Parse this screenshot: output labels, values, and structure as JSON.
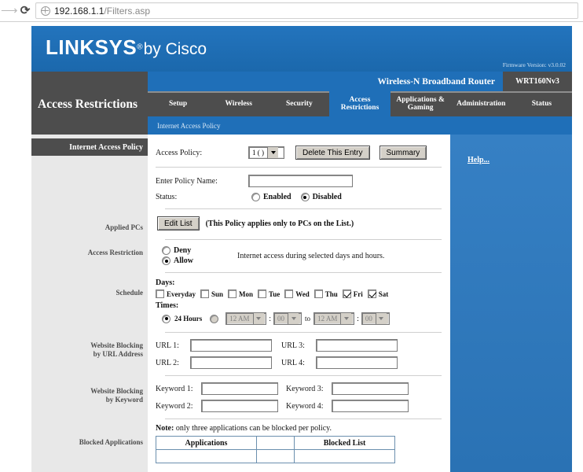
{
  "browser": {
    "forward_icon": "forward-arrow-icon",
    "reload_icon": "reload-icon",
    "reload_glyph": "⟳",
    "site_icon": "globe-icon",
    "url_host": "192.168.1.1",
    "url_path": "/Filters.asp"
  },
  "masthead": {
    "brand": "LINKSYS",
    "brand_reg": "®",
    "brand_suffix": "by Cisco",
    "firmware": "Firmware Version: v3.0.02",
    "router_name": "Wireless-N Broadband Router",
    "model": "WRT160Nv3"
  },
  "nav": {
    "section_title": "Access Restrictions",
    "tabs": [
      {
        "label": "Setup",
        "active": false
      },
      {
        "label": "Wireless",
        "active": false
      },
      {
        "label": "Security",
        "active": false
      },
      {
        "label": "Access Restrictions",
        "active": true
      },
      {
        "label": "Applications & Gaming",
        "active": false
      },
      {
        "label": "Administration",
        "active": false
      },
      {
        "label": "Status",
        "active": false
      }
    ],
    "subtabs": [
      {
        "label": "Internet Access Policy",
        "active": true
      }
    ]
  },
  "sidebar": {
    "header": "Internet Access Policy",
    "items": [
      {
        "label": "Applied PCs"
      },
      {
        "label": "Access Restriction"
      },
      {
        "label": "Schedule"
      },
      {
        "label": "Website Blocking\nby URL Address"
      },
      {
        "label": "Website Blocking\nby Keyword"
      },
      {
        "label": "Blocked Applications"
      }
    ],
    "applied_pcs": "Applied PCs",
    "access_restriction": "Access Restriction",
    "schedule": "Schedule",
    "url_block_l1": "Website Blocking",
    "url_block_l2": "by URL Address",
    "kw_block_l1": "Website Blocking",
    "kw_block_l2": "by Keyword",
    "blocked_apps": "Blocked Applications"
  },
  "form": {
    "access_policy_label": "Access Policy:",
    "access_policy_value": "1 ( )",
    "delete_button": "Delete This Entry",
    "summary_button": "Summary",
    "policy_name_label": "Enter Policy Name:",
    "policy_name_value": "",
    "policy_name_placeholder": "",
    "status_label": "Status:",
    "status_enabled": "Enabled",
    "status_disabled": "Disabled",
    "status_selected": "Disabled",
    "edit_list_button": "Edit List",
    "applied_pcs_note": "(This Policy applies only to PCs on the List.)",
    "restriction_deny": "Deny",
    "restriction_allow": "Allow",
    "restriction_selected": "Allow",
    "restriction_note": "Internet access during selected days and hours.",
    "days_label": "Days:",
    "days": [
      {
        "name": "Everyday",
        "checked": false
      },
      {
        "name": "Sun",
        "checked": false
      },
      {
        "name": "Mon",
        "checked": false
      },
      {
        "name": "Tue",
        "checked": false
      },
      {
        "name": "Wed",
        "checked": false
      },
      {
        "name": "Thu",
        "checked": false
      },
      {
        "name": "Fri",
        "checked": true
      },
      {
        "name": "Sat",
        "checked": true
      }
    ],
    "times_label": "Times:",
    "times_24h_label": "24 Hours",
    "times_mode": "24 Hours",
    "time_from_hour": "12 AM",
    "time_from_min": "00",
    "time_to_word": "to",
    "time_to_hour": "12 AM",
    "time_to_min": "00",
    "time_colon": ":",
    "urls": [
      {
        "label": "URL 1:",
        "value": ""
      },
      {
        "label": "URL 2:",
        "value": ""
      },
      {
        "label": "URL 3:",
        "value": ""
      },
      {
        "label": "URL 4:",
        "value": ""
      }
    ],
    "keywords": [
      {
        "label": "Keyword 1:",
        "value": ""
      },
      {
        "label": "Keyword 2:",
        "value": ""
      },
      {
        "label": "Keyword 3:",
        "value": ""
      },
      {
        "label": "Keyword 4:",
        "value": ""
      }
    ],
    "apps_note_bold": "Note:",
    "apps_note_rest": " only three applications can be blocked per policy.",
    "apps_table": {
      "col_applications": "Applications",
      "col_blocked_list": "Blocked List"
    }
  },
  "help": {
    "link": "Help..."
  },
  "colors": {
    "brand_blue": "#1f6fb8",
    "panel_blue": "#2e79bd",
    "dark_gray": "#4d4d4d",
    "sidebar_gray": "#e8e8e8",
    "control_face": "#d4d0c8"
  }
}
